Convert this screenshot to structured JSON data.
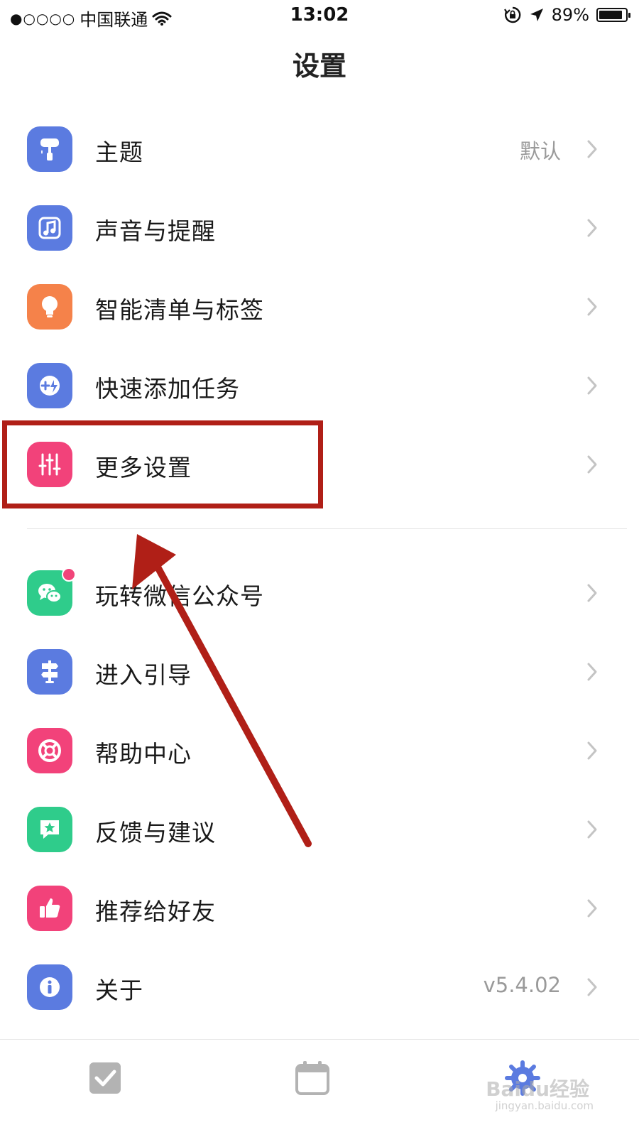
{
  "status_bar": {
    "signal": "●○○○○",
    "carrier": "中国联通",
    "time": "13:02",
    "battery_text": "89%",
    "battery_level": 0.89
  },
  "nav": {
    "title": "设置"
  },
  "settings_group_1": [
    {
      "label": "主题",
      "value": "默认",
      "icon": "paint-roller-icon",
      "color": "#5b7be0"
    },
    {
      "label": "声音与提醒",
      "value": "",
      "icon": "music-note-icon",
      "color": "#5b7be0"
    },
    {
      "label": "智能清单与标签",
      "value": "",
      "icon": "light-bulb-icon",
      "color": "#f5824a"
    },
    {
      "label": "快速添加任务",
      "value": "",
      "icon": "quick-add-icon",
      "color": "#5b7be0"
    },
    {
      "label": "更多设置",
      "value": "",
      "icon": "sliders-icon",
      "color": "#f2427a"
    }
  ],
  "settings_group_2": [
    {
      "label": "玩转微信公众号",
      "value": "",
      "icon": "wechat-icon",
      "color": "#2fcc8b"
    },
    {
      "label": "进入引导",
      "value": "",
      "icon": "signpost-icon",
      "color": "#5b7be0"
    },
    {
      "label": "帮助中心",
      "value": "",
      "icon": "lifebuoy-icon",
      "color": "#f2427a"
    },
    {
      "label": "反馈与建议",
      "value": "",
      "icon": "feedback-star-icon",
      "color": "#2fcc8b"
    },
    {
      "label": "推荐给好友",
      "value": "",
      "icon": "thumbs-up-icon",
      "color": "#f2427a"
    },
    {
      "label": "关于",
      "value": "v5.4.02",
      "icon": "info-icon",
      "color": "#5b7be0"
    }
  ],
  "tab_bar": {
    "tabs": [
      {
        "icon": "checkbox-icon"
      },
      {
        "icon": "calendar-icon"
      },
      {
        "icon": "settings-icon"
      }
    ]
  },
  "watermark": {
    "text": "Baidu经验",
    "sub": "jingyan.baidu.com"
  },
  "annotation": {
    "color": "#b01f17"
  }
}
